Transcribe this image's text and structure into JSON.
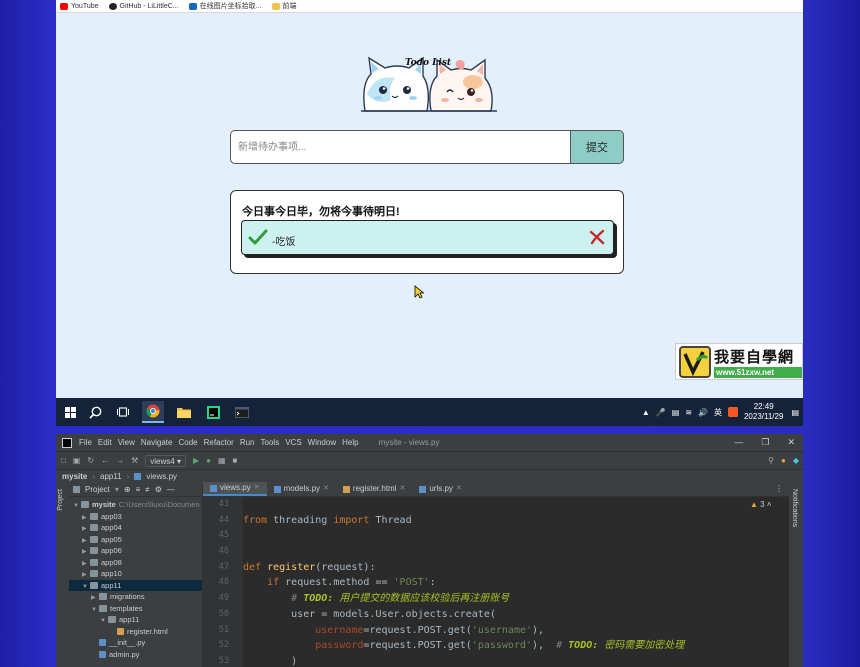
{
  "browser": {
    "bookmarks": [
      {
        "label": "YouTube",
        "color": "#ff0000"
      },
      {
        "label": "GitHub - LiLittleC...",
        "color": "#222222"
      },
      {
        "label": "在线图片坐标拾取...",
        "color": "#1565c0"
      },
      {
        "label": "前端",
        "color": "#f2c14e"
      }
    ],
    "logo_text": "Todo List",
    "input_placeholder": "新增待办事项...",
    "submit_label": "提交",
    "card_heading": "今日事今日毕，勿将今事待明日!",
    "todos": [
      {
        "text": "-吃饭",
        "done": true
      }
    ],
    "watermark_text": "我要自學網",
    "watermark_url": "www.51zxw.net"
  },
  "taskbar": {
    "time": "22:49",
    "date": "2023/11/29",
    "ime": "英"
  },
  "ide": {
    "menu": [
      "File",
      "Edit",
      "View",
      "Navigate",
      "Code",
      "Refactor",
      "Run",
      "Tools",
      "VCS",
      "Window",
      "Help"
    ],
    "title": "mysite - views.py",
    "run_config": "views4",
    "breadcrumb": [
      "mysite",
      "app11",
      "views.py"
    ],
    "project_label": "Project",
    "side_left_label": "Project",
    "side_right_label": "Notifications",
    "inspections": "3",
    "tabs": [
      {
        "label": "views.py",
        "active": true
      },
      {
        "label": "models.py",
        "active": false
      },
      {
        "label": "register.html",
        "active": false
      },
      {
        "label": "urls.py",
        "active": false
      }
    ],
    "tree": [
      {
        "label": "mysite",
        "extra": "C:\\Users\\liuxu\\Documen",
        "depth": 0,
        "type": "folder",
        "open": true
      },
      {
        "label": "app03",
        "depth": 1,
        "type": "folder"
      },
      {
        "label": "app04",
        "depth": 1,
        "type": "folder"
      },
      {
        "label": "app05",
        "depth": 1,
        "type": "folder"
      },
      {
        "label": "app06",
        "depth": 1,
        "type": "folder"
      },
      {
        "label": "app08",
        "depth": 1,
        "type": "folder"
      },
      {
        "label": "app10",
        "depth": 1,
        "type": "folder"
      },
      {
        "label": "app11",
        "depth": 1,
        "type": "folder",
        "open": true,
        "selected": true
      },
      {
        "label": "migrations",
        "depth": 2,
        "type": "folder"
      },
      {
        "label": "templates",
        "depth": 2,
        "type": "folder",
        "open": true
      },
      {
        "label": "app11",
        "depth": 3,
        "type": "folder",
        "open": true
      },
      {
        "label": "register.html",
        "depth": 4,
        "type": "html"
      },
      {
        "label": "__init__.py",
        "depth": 2,
        "type": "py"
      },
      {
        "label": "admin.py",
        "depth": 2,
        "type": "py"
      }
    ],
    "line_numbers": [
      "43",
      "44",
      "45",
      "46",
      "47",
      "48",
      "49",
      "50",
      "51",
      "52",
      "53"
    ],
    "code": {
      "l44_kw1": "from",
      "l44_mod": " threading ",
      "l44_kw2": "import",
      "l44_cls": " Thread",
      "l47_kw": "def ",
      "l47_fn": "register",
      "l47_rest": "(request):",
      "l48_indent": "    ",
      "l48_kw": "if",
      "l48_rest": " request.method == ",
      "l48_str": "'POST'",
      "l48_colon": ":",
      "l49_indent": "        ",
      "l49_hash": "# ",
      "l49_todo": "TODO:",
      "l49_text": " 用户提交的数据应该校验后再注册账号",
      "l50_text": "        user = models.User.objects.create(",
      "l51_indent": "            ",
      "l51_key": "username",
      "l51_mid": "=request.POST.get(",
      "l51_str": "'username'",
      "l51_end": "),",
      "l52_indent": "            ",
      "l52_key": "password",
      "l52_mid": "=request.POST.get(",
      "l52_str": "'password'",
      "l52_end": "),  ",
      "l52_hash": "# ",
      "l52_todo": "TODO:",
      "l52_text": " 密码需要加密处理",
      "l53_text": "        )"
    }
  }
}
